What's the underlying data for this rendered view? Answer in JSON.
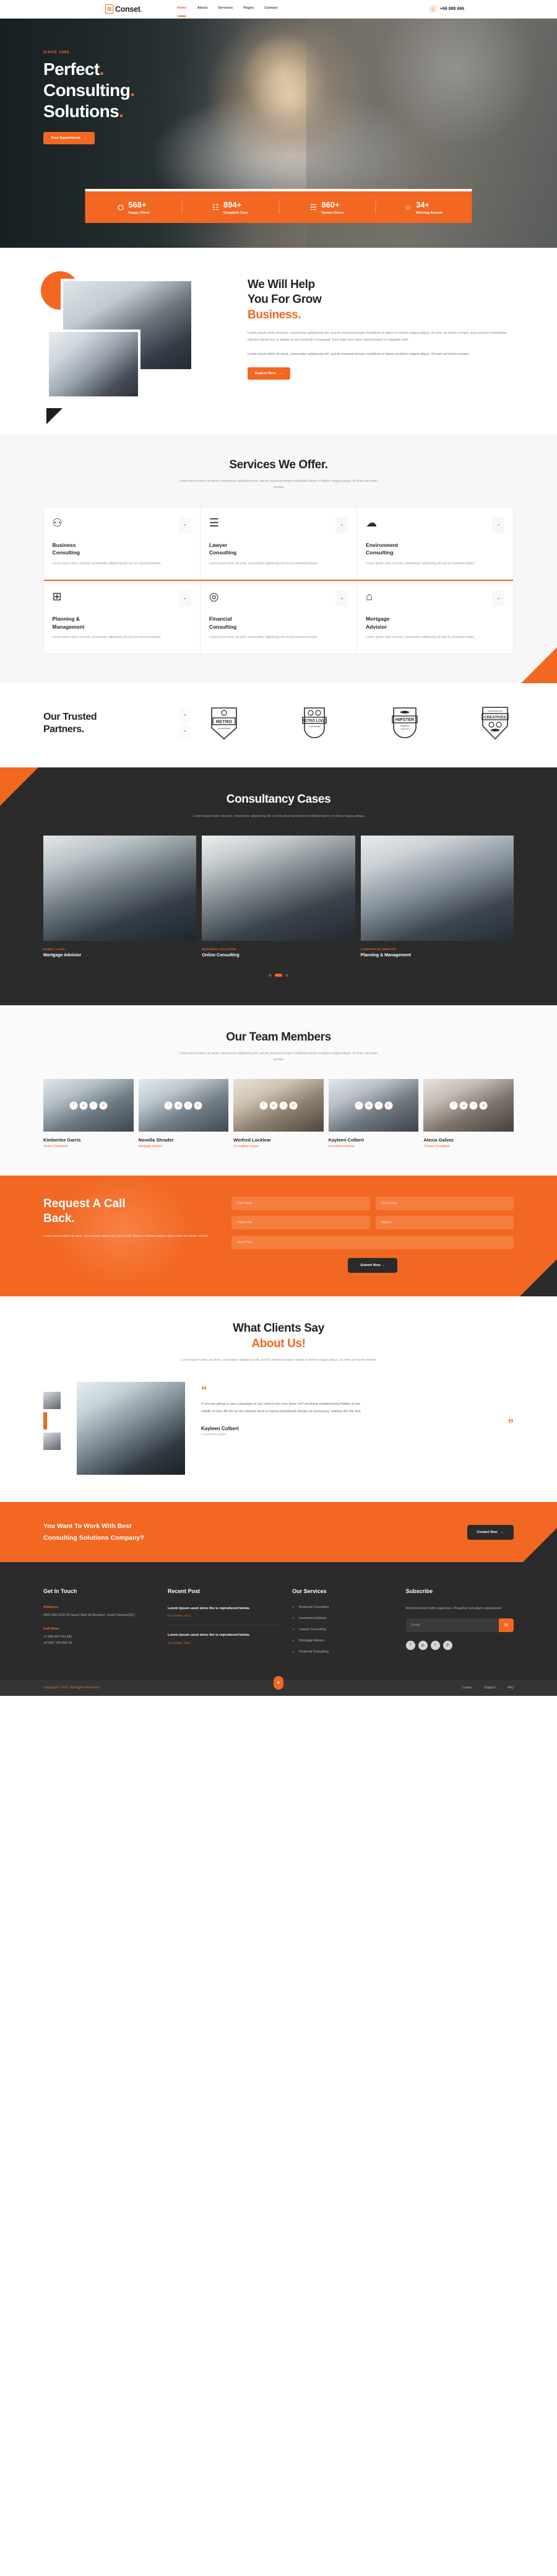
{
  "brand": {
    "name": "Conset",
    "dot": ".",
    "logo_icon": "document-pen-icon"
  },
  "header": {
    "nav": [
      {
        "label": "Home",
        "active": true
      },
      {
        "label": "About",
        "active": false
      },
      {
        "label": "Services",
        "active": false
      },
      {
        "label": "Pages",
        "active": false
      },
      {
        "label": "Contact",
        "active": false
      }
    ],
    "phone_icon": "headset-icon",
    "phone": "+66 888 666"
  },
  "hero": {
    "since": "SINCE 1996.",
    "title_line1": "Perfect",
    "title_line2": "Consulting",
    "title_line3": "Solutions",
    "dot": ".",
    "cta": "Free Appointment",
    "cta_arrow": "→"
  },
  "stats": [
    {
      "icon": "users-group-icon",
      "glyph": "⛭",
      "value": "568+",
      "label": "Happy Client"
    },
    {
      "icon": "document-edit-icon",
      "glyph": "☷",
      "value": "894+",
      "label": "Complete Case"
    },
    {
      "icon": "monitor-user-icon",
      "glyph": "☰",
      "value": "860+",
      "label": "Guides Given"
    },
    {
      "icon": "award-star-icon",
      "glyph": "☆",
      "value": "34+",
      "label": "Winning Awards"
    }
  ],
  "about": {
    "title_l1": "We Will Help",
    "title_l2": "You For Grow",
    "title_l3": "Business.",
    "para1": "Lorem ipsum dolor sit amet, consectetur adipisicing elit, sed do eiusmod tempor incididunt ut labore et dolore magna aliqua. Ut enim ad minim veniam, quis nostrud exercitation ullamco aboris nisi ut aliquip ex ea commodo consequat. Duis aute irure dolor reprehenderit in voluptate velit.",
    "para2": "Lorem ipsum dolor sit amet, consectetur adipisicing elit, sed do eiusmod tempor incididunt ut labore et dolore magna aliqua. Ut enim ad minim veniam.",
    "btn": "Explore More",
    "btn_arrow": "→"
  },
  "services": {
    "title": "Services We Offer.",
    "sub": "Lorem ipsum dolor sit amet, consectetur adipisicing elit, sed do eiusmod tempor incididunt labore et dolore magna aliqua. Ut enim ad minim veniam",
    "arrow": "»",
    "items": [
      {
        "icon": "chat-people-icon",
        "glyph": "⚇",
        "name_l1": "Business",
        "name_l2": "Consulting",
        "desc": "Lorem ipsum dolor sit amet, consectetur adipisicing elit sed do eiusmod tempor."
      },
      {
        "icon": "document-person-icon",
        "glyph": "☰",
        "name_l1": "Lawyer",
        "name_l2": "Consulting",
        "desc": "Lorem ipsum dolor sit amet, consectetur adipisicing elit sed do eiusmod tempor."
      },
      {
        "icon": "sun-cloud-icon",
        "glyph": "☁",
        "name_l1": "Environment",
        "name_l2": "Consulting",
        "desc": "Lorem ipsum dolor sit amet, consectetur adipisicing elit sed do eiusmod tempor."
      },
      {
        "icon": "chart-plan-icon",
        "glyph": "⊞",
        "name_l1": "Planning &",
        "name_l2": "Management",
        "desc": "Lorem ipsum dolor sit amet, consectetur adipisicing elit sed do eiusmod tempor."
      },
      {
        "icon": "coin-money-icon",
        "glyph": "◎",
        "name_l1": "Financial",
        "name_l2": "Consulting",
        "desc": "Lorem ipsum dolor sit amet, consectetur adipisicing elit sed do eiusmod tempor."
      },
      {
        "icon": "house-key-icon",
        "glyph": "⌂",
        "name_l1": "Mortgage",
        "name_l2": "Advisior",
        "desc": "Lorem ipsum dolor sit amet, consectetur adipisicing elit sed do eiusmod tempor."
      }
    ]
  },
  "partners": {
    "title_l1": "Our Trusted",
    "title_l2": "Partners.",
    "prev": "«",
    "next": "»",
    "logos": [
      {
        "icon": "retro-badge-icon",
        "text": "RETRO",
        "sub": "GUARANTEED"
      },
      {
        "icon": "retro-logo-badge-icon",
        "text": "RETRO LOGO",
        "sub": "GUARANTEED"
      },
      {
        "icon": "hipster-badge-icon",
        "text": "HIPSTER",
        "sub": "PREMIUM QUALITY"
      },
      {
        "icon": "creatives-badge-icon",
        "text": "CREATIVES",
        "sub": "ESTABLISHED"
      }
    ]
  },
  "cases": {
    "title": "Consultancy Cases",
    "sub": "Lorem ipsum dolor sit amet, consectetur adipisicing elit, sed do eiusmod tempor incididunt labore et dolore magna aliqua",
    "items": [
      {
        "cat": "HOME / LOAN",
        "name": "Mortgage Advisior"
      },
      {
        "cat": "BUSINESS SOLUTION",
        "name": "Online Consulting"
      },
      {
        "cat": "CORPORATE SERVICE",
        "name": "Planning & Management"
      }
    ]
  },
  "team": {
    "title": "Our Team Members",
    "sub": "Lorem ipsum dolor sit amet, consectetur adipisicing elit, sed do eiusmod tempor incididunt labore et dolore magna aliqua. Ut enim ad minim veniam",
    "socials": [
      "f",
      "◎",
      "t",
      "p"
    ],
    "members": [
      {
        "name": "Kimberlee Garris",
        "role": "Senior Consultant"
      },
      {
        "name": "Novella Shrader",
        "role": "Mortgage Advisor"
      },
      {
        "name": "Winfred Locklear",
        "role": "Consulting Lawyer"
      },
      {
        "name": "Kayleen Colbert",
        "role": "Investment Advisor"
      },
      {
        "name": "Alexia Galvez",
        "role": "Trainee Consultant"
      }
    ]
  },
  "callback": {
    "title_l1": "Request A Call",
    "title_l2": "Back.",
    "desc": "Lorem ipsum dolor sit amet, consectetur adipisicing elit sed do labore et dolore magna aliqua enim ad minim veniam.",
    "full_name_ph": "Full Name",
    "email_ph": "Email Here",
    "phone_ph": "Phone No.",
    "subject_ph": "Subject",
    "short_text_ph": "Short Text",
    "submit": "Submit Now",
    "submit_arrow": "→"
  },
  "testimonial": {
    "title_l1": "What Clients Say",
    "title_l2": "About Us!",
    "sub": "Lorem ipsum dolor sit amet, consectetur adipisicing elit, sed do eiusmod tempor labore et dolore magna aliqua. Ut enim ad minim veniam",
    "quote_open": "“",
    "quote_close": "”",
    "text": "If you are going to use a passage of you need to be sure there isn't anything embarrassing hidden in the middle of text. All the on the internet tend to repeat predefined chunks as necessary, making this the first",
    "name": "Kayleen Colbert",
    "role": "Investment Advisor"
  },
  "cta": {
    "line1": "You Want To Work With Best",
    "line2": "Consulting Solutions Company?",
    "btn": "Contact Now",
    "btn_arrow": "→"
  },
  "footer": {
    "contact": {
      "heading": "Get In Touch",
      "address_label": "Address:",
      "address": "(843) 846-2230 20 Island Tank Rd Beaufort, South Carolina(SC).",
      "call_label": "Call Now:",
      "phone1": "+2 568 964 793 682",
      "phone2": "+8 6967 329 863 46"
    },
    "recent": {
      "heading": "Recent Post",
      "posts": [
        {
          "title": "Lorem Ipsum used since the is reproduced below.",
          "date": "01 October, 2021"
        },
        {
          "title": "Lorem Ipsum used since the is reproduced below.",
          "date": "01 October, 2021"
        }
      ]
    },
    "services": {
      "heading": "Our Services",
      "arrow": "»",
      "items": [
        "Business Consulting",
        "Investment Advisor",
        "Lawyer Consulting",
        "Mortgage Advisor",
        "Financial Consulting"
      ]
    },
    "subscribe": {
      "heading": "Subscribe",
      "text": "Morbi interdum mollis sapierisus. Phasellus lacinullam corpelaoreet.",
      "email_ph": "Email",
      "submit_icon": "envelope-icon",
      "socials": [
        {
          "icon": "facebook-icon",
          "glyph": "f"
        },
        {
          "icon": "instagram-icon",
          "glyph": "◎"
        },
        {
          "icon": "twitter-icon",
          "glyph": "t"
        },
        {
          "icon": "pinterest-icon",
          "glyph": "p"
        }
      ]
    }
  },
  "bottom": {
    "copy_pre": "Copyright © ",
    "year": "2021",
    "copy_post": " | All Rights Reserved.",
    "top_icon": "arrow-up-icon",
    "links": [
      "Career",
      "Support",
      "FAQ"
    ],
    "sep": "|"
  },
  "colors": {
    "accent": "#f26722",
    "dark": "#2b2b2b",
    "light": "#f7f7f7"
  }
}
